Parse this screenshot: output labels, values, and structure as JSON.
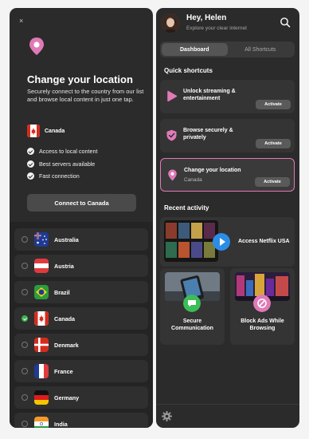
{
  "left": {
    "close_label": "×",
    "title": "Change your location",
    "description": "Securely connect to the country from our list and browse local content in just one tap.",
    "current_country": "Canada",
    "features": [
      "Access to local content",
      "Best servers available",
      "Fast connection"
    ],
    "connect_label": "Connect to Canada",
    "countries": [
      {
        "name": "Australia",
        "selected": false
      },
      {
        "name": "Austria",
        "selected": false
      },
      {
        "name": "Brazil",
        "selected": false
      },
      {
        "name": "Canada",
        "selected": true
      },
      {
        "name": "Denmark",
        "selected": false
      },
      {
        "name": "France",
        "selected": false
      },
      {
        "name": "Germany",
        "selected": false
      },
      {
        "name": "India",
        "selected": false
      }
    ]
  },
  "right": {
    "greeting": "Hey, Helen",
    "subtitle": "Explore your clear internet",
    "tabs": [
      {
        "label": "Dashboard",
        "active": true
      },
      {
        "label": "All Shortcuts",
        "active": false
      }
    ],
    "quick_title": "Quick shortcuts",
    "shortcuts": [
      {
        "title": "Unlock streaming & entertainment",
        "sub": "",
        "action": "Activate",
        "icon": "play-icon"
      },
      {
        "title": "Browse securely & privately",
        "sub": "",
        "action": "Activate",
        "icon": "shield-check-icon"
      },
      {
        "title": "Change your location",
        "sub": "Canada",
        "action": "Activate",
        "icon": "location-pin-icon"
      }
    ],
    "recent_title": "Recent activity",
    "recent": [
      {
        "label": "Access Netflix USA",
        "icon": "play-icon"
      },
      {
        "label": "Secure Communication",
        "icon": "chat-icon"
      },
      {
        "label": "Block Ads While Browsing",
        "icon": "block-icon"
      }
    ]
  },
  "colors": {
    "accent": "#e07ab7",
    "panel": "#2b2b2b",
    "card": "#343434",
    "check_green": "#3bb34a",
    "play_blue": "#2d8de6",
    "chat_green": "#3bbd58"
  }
}
